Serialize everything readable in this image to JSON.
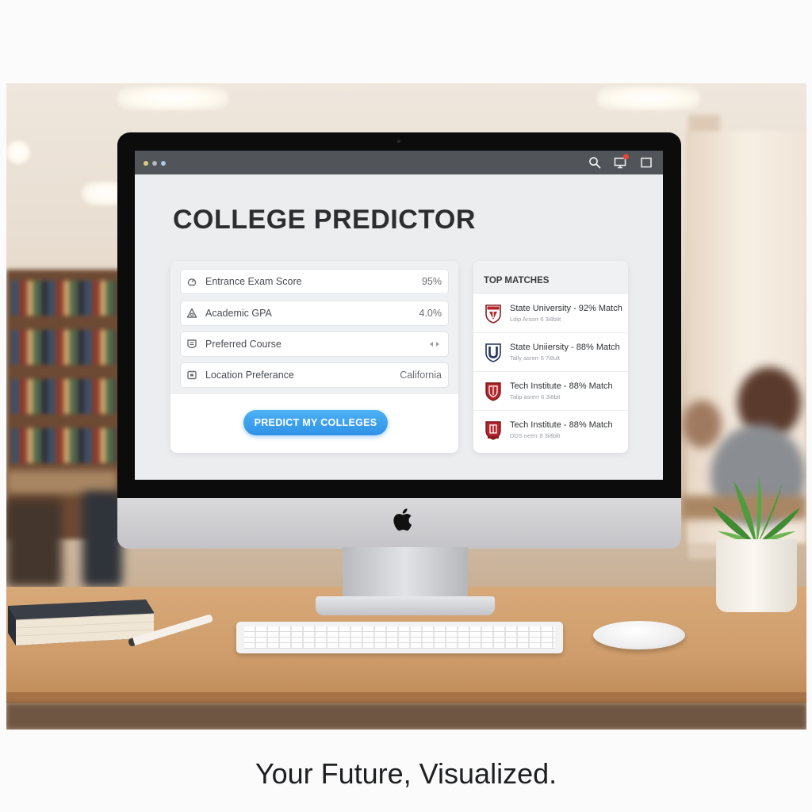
{
  "app": {
    "title": "COLLEGE PREDICTOR"
  },
  "window": {
    "controls": [
      "close",
      "minimize",
      "maximize"
    ],
    "toolbar_icons": [
      "search-icon",
      "notification-icon",
      "window-icon"
    ]
  },
  "form": {
    "fields": [
      {
        "label": "Entrance Exam Score",
        "value": "95%",
        "icon": "score-icon"
      },
      {
        "label": "Academic GPA",
        "value": "4.0%",
        "icon": "gpa-icon"
      },
      {
        "label": "Preferred Course",
        "value": "",
        "icon": "course-icon",
        "value_icon": "dropdown-arrows-icon"
      },
      {
        "label": "Location Preferance",
        "value": "California",
        "icon": "location-icon"
      }
    ],
    "submit_label": "PREDICT MY COLLEGES"
  },
  "matches": {
    "title": "TOP MATCHES",
    "items": [
      {
        "name": "State University - 92% Match",
        "sub": "Ldip Arsorr 6 3i8blit",
        "crest": "crest-icon"
      },
      {
        "name": "State Uniiersity - 88% Match",
        "sub": "Tally asrerr 6 7i8ult",
        "crest": "crest-u-icon"
      },
      {
        "name": "Tech Institute - 88% Match",
        "sub": "Talip asrerr 6 3i8bit",
        "crest": "crest-icon"
      },
      {
        "name": "Tech Institute - 88% Match",
        "sub": "DDS neerr 8 3i8blit",
        "crest": "crest-icon"
      }
    ]
  },
  "colors": {
    "accent": "#2f91e6",
    "title_text": "#2c2e31",
    "crest_red": "#b3262b",
    "crest_navy": "#24345f"
  },
  "caption": "Your Future, Visualized."
}
